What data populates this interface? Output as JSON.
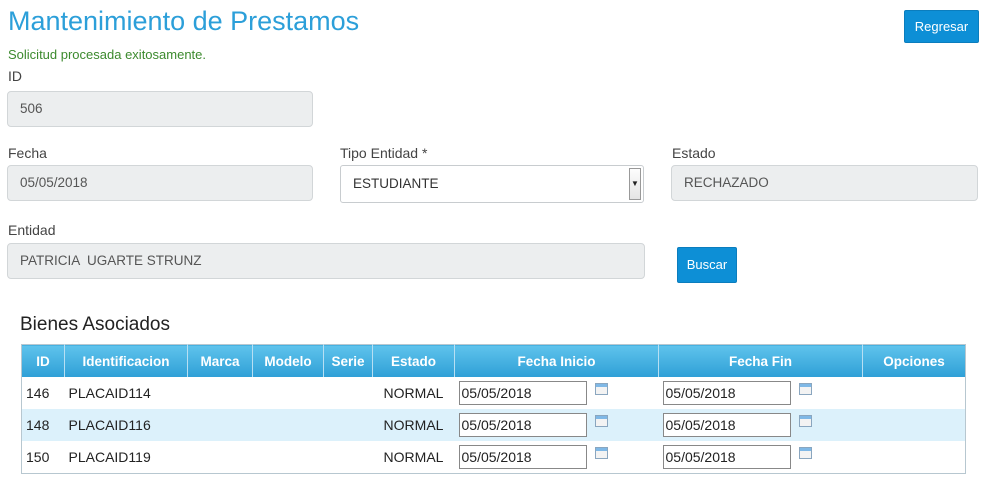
{
  "header": {
    "title": "Mantenimiento de Prestamos",
    "back_label": "Regresar"
  },
  "message": "Solicitud procesada exitosamente.",
  "form": {
    "id_label": "ID",
    "id_value": "506",
    "fecha_label": "Fecha",
    "fecha_value": "05/05/2018",
    "tipo_label": "Tipo Entidad *",
    "tipo_value": "ESTUDIANTE",
    "estado_label": "Estado",
    "estado_value": "RECHAZADO",
    "entidad_label": "Entidad",
    "entidad_value": "PATRICIA  UGARTE STRUNZ",
    "buscar_label": "Buscar"
  },
  "bienes": {
    "title": "Bienes Asociados",
    "columns": [
      "ID",
      "Identificacion",
      "Marca",
      "Modelo",
      "Serie",
      "Estado",
      "Fecha Inicio",
      "Fecha Fin",
      "Opciones"
    ],
    "rows": [
      {
        "id": "146",
        "ident": "PLACAID114",
        "marca": "",
        "modelo": "",
        "serie": "",
        "estado": "NORMAL",
        "inicio": "05/05/2018",
        "fin": "05/05/2018"
      },
      {
        "id": "148",
        "ident": "PLACAID116",
        "marca": "",
        "modelo": "",
        "serie": "",
        "estado": "NORMAL",
        "inicio": "05/05/2018",
        "fin": "05/05/2018"
      },
      {
        "id": "150",
        "ident": "PLACAID119",
        "marca": "",
        "modelo": "",
        "serie": "",
        "estado": "NORMAL",
        "inicio": "05/05/2018",
        "fin": "05/05/2018"
      }
    ]
  },
  "colors": {
    "accent": "#2c9fd9",
    "button": "#0d8fd6",
    "success": "#3c8a2e",
    "header_top": "#5fc3ec",
    "header_bottom": "#2e9fd6",
    "row_alt": "#dcf1fb"
  }
}
